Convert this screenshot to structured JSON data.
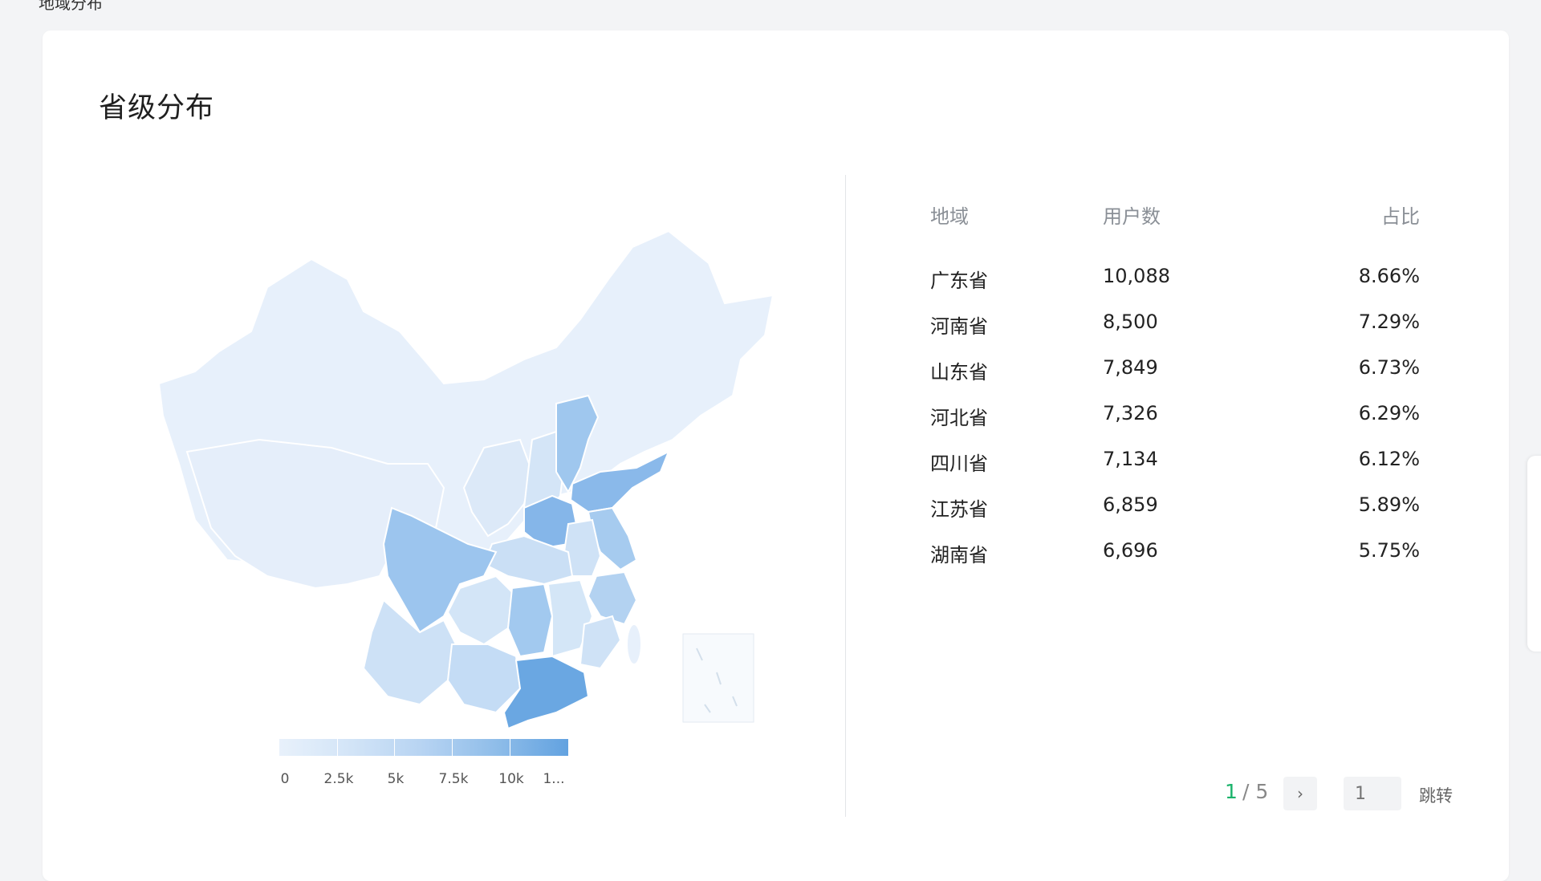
{
  "header": {
    "crumb": "地域分布"
  },
  "card": {
    "title": "省级分布"
  },
  "legend": {
    "ticks": [
      "0",
      "2.5k",
      "5k",
      "7.5k",
      "10k",
      "1..."
    ]
  },
  "colors": {
    "scale": [
      "#e8f1fb",
      "#d2e4f7",
      "#b6d3f2",
      "#8fbde9",
      "#62a2e0"
    ],
    "accent_page": "#1ab36b"
  },
  "table": {
    "headers": {
      "region": "地域",
      "users": "用户数",
      "share": "占比"
    },
    "rows": [
      {
        "region": "广东省",
        "users": "10,088",
        "share": "8.66%"
      },
      {
        "region": "河南省",
        "users": "8,500",
        "share": "7.29%"
      },
      {
        "region": "山东省",
        "users": "7,849",
        "share": "6.73%"
      },
      {
        "region": "河北省",
        "users": "7,326",
        "share": "6.29%"
      },
      {
        "region": "四川省",
        "users": "7,134",
        "share": "6.12%"
      },
      {
        "region": "江苏省",
        "users": "6,859",
        "share": "5.89%"
      },
      {
        "region": "湖南省",
        "users": "6,696",
        "share": "5.75%"
      }
    ]
  },
  "pager": {
    "current": "1",
    "separator_total": "/ 5",
    "next_icon": "chevron-right-icon",
    "next_glyph": "›",
    "jump_placeholder": "1",
    "jump_label": "跳转"
  }
}
